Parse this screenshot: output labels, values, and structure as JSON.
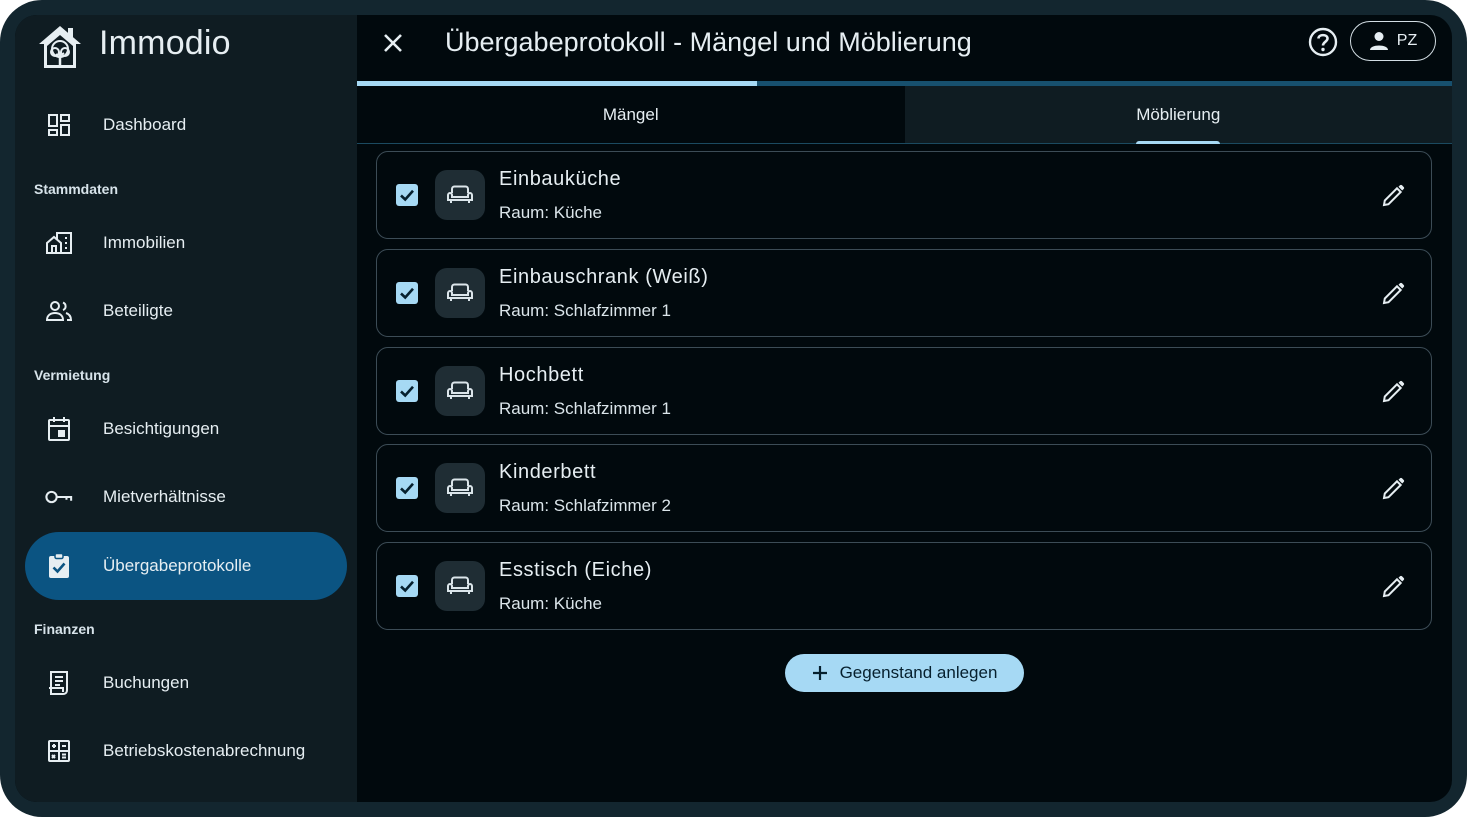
{
  "app": {
    "name": "Immodio"
  },
  "header": {
    "title": "Übergabeprotokoll - Mängel und Möblierung",
    "user_initials": "PZ"
  },
  "progress": {
    "value": 0.365
  },
  "sidebar": {
    "items": [
      {
        "label": "Dashboard",
        "icon": "dashboard-icon"
      },
      {
        "label": "Immobilien",
        "icon": "building-icon"
      },
      {
        "label": "Beteiligte",
        "icon": "people-icon"
      },
      {
        "label": "Besichtigungen",
        "icon": "calendar-icon"
      },
      {
        "label": "Mietverhältnisse",
        "icon": "key-icon"
      },
      {
        "label": "Übergabeprotokolle",
        "icon": "clipboard-check-icon",
        "active": true
      },
      {
        "label": "Buchungen",
        "icon": "receipt-icon"
      },
      {
        "label": "Betriebskostenabrechnung",
        "icon": "calculator-icon"
      }
    ],
    "sections": [
      "Stammdaten",
      "Vermietung",
      "Finanzen"
    ]
  },
  "tabs": [
    {
      "label": "Mängel",
      "active": false
    },
    {
      "label": "Möblierung",
      "active": true
    }
  ],
  "furniture": [
    {
      "name": "Einbauküche",
      "room": "Raum: Küche",
      "checked": true
    },
    {
      "name": "Einbauschrank (Weiß)",
      "room": "Raum: Schlafzimmer 1",
      "checked": true
    },
    {
      "name": "Hochbett",
      "room": "Raum: Schlafzimmer 1",
      "checked": true
    },
    {
      "name": "Kinderbett",
      "room": "Raum: Schlafzimmer 2",
      "checked": true
    },
    {
      "name": "Esstisch (Eiche)",
      "room": "Raum: Küche",
      "checked": true
    }
  ],
  "add_button": {
    "label": "Gegenstand anlegen"
  },
  "colors": {
    "accent": "#a6d9f4",
    "active_nav": "#0b5482",
    "background": "#01090d",
    "sidebar": "#0f1c22"
  }
}
